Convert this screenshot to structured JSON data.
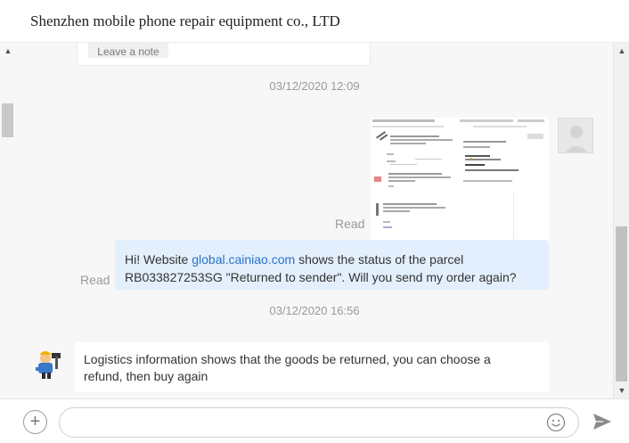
{
  "header": {
    "title": "Shenzhen mobile phone repair equipment co., LTD"
  },
  "note_card": {
    "button_label": "Leave a note"
  },
  "timestamps": [
    "03/12/2020 12:09",
    "03/12/2020 16:56"
  ],
  "messages": {
    "image_msg": {
      "status": "Read"
    },
    "text_msg": {
      "status": "Read",
      "prefix": "Hi! Website ",
      "link": "global.cainiao.com",
      "suffix": " shows the status of the parcel",
      "line2": "RB033827253SG \"Returned to sender\". Will you send my order again?"
    },
    "reply_msg": {
      "line1": "Logistics information shows that the goods be returned, you can choose a",
      "line2": "refund, then buy again"
    }
  },
  "input": {
    "placeholder": "",
    "value": ""
  },
  "colors": {
    "accent_link": "#2a72c8",
    "bubble_right": "#e3effd",
    "chat_bg": "#f7f7f7"
  },
  "icons": {
    "plus": "plus-icon",
    "emoji": "emoji-icon",
    "send": "send-icon",
    "scroll_up": "chevron-up-icon",
    "scroll_down": "chevron-down-icon"
  }
}
